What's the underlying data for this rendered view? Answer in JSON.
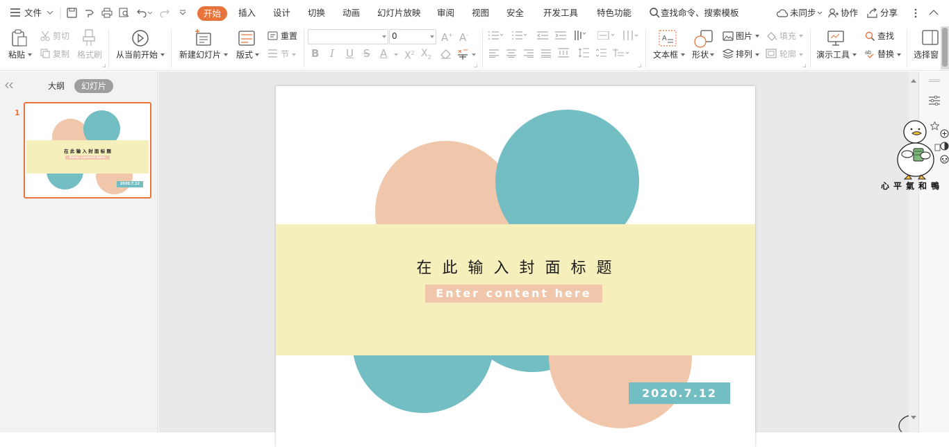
{
  "colors": {
    "accent": "#e8743b",
    "peach": "#f0c7aa",
    "teal": "#72bec3",
    "band": "#f5efbb",
    "date_bg": "#72bec3"
  },
  "menubar": {
    "file": "文件",
    "tabs": [
      "开始",
      "插入",
      "设计",
      "切换",
      "动画",
      "幻灯片放映",
      "审阅",
      "视图",
      "安全",
      "开发工具",
      "特色功能"
    ],
    "search": "查找命令、搜索模板",
    "sync": "未同步",
    "collab": "协作",
    "share": "分享"
  },
  "ribbon": {
    "paste": "粘贴",
    "cut": "剪切",
    "copy": "复制",
    "format_painter": "格式刷",
    "play_from_current": "从当前开始",
    "new_slide": "新建幻灯片",
    "layout": "版式",
    "reset": "重置",
    "section": "节",
    "font_size": "0",
    "textbox": "文本框",
    "shape": "形状",
    "picture": "图片",
    "fill": "填充",
    "arrange": "排列",
    "outline": "轮廓",
    "present_tools": "演示工具",
    "find": "查找",
    "replace": "替换",
    "select_pane": "选择窗"
  },
  "leftpane": {
    "outline_tab": "大纲",
    "slides_tab": "幻灯片",
    "slide_number": "1"
  },
  "slide": {
    "title": "在 此 输 入 封 面 标 题",
    "subtitle": "Enter content here",
    "date": "2020.7.12"
  },
  "sticker": {
    "caption": "心平氣和鴨"
  }
}
